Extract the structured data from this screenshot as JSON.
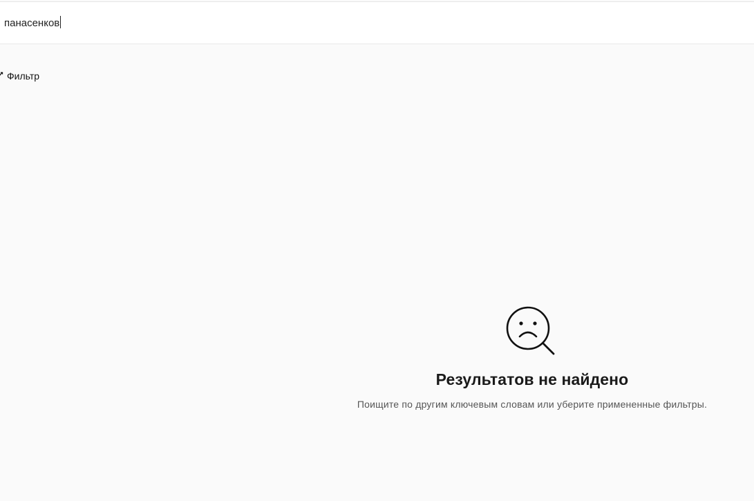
{
  "search": {
    "value": "панасенков",
    "placeholder": ""
  },
  "filter": {
    "label": "Фильтр",
    "icon": "filter-icon"
  },
  "empty_state": {
    "icon": "sad-search-icon",
    "title": "Результатов не найдено",
    "subtitle": "Поищите по другим ключевым словам или уберите примененные фильтры."
  }
}
